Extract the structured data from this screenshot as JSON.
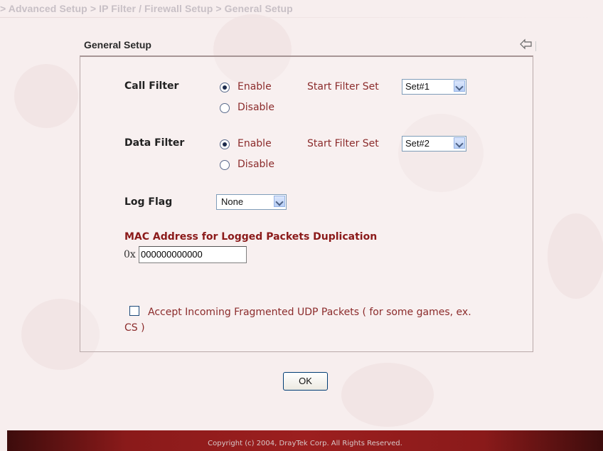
{
  "breadcrumb": "> Advanced Setup > IP Filter / Firewall Setup > General Setup",
  "section_title": "General Setup",
  "icons": {
    "back": "back-arrow-icon"
  },
  "call_filter": {
    "label": "Call Filter",
    "enable_label": "Enable",
    "disable_label": "Disable",
    "selected": "Enable",
    "start_set_label": "Start Filter Set",
    "start_set_value": "Set#1"
  },
  "data_filter": {
    "label": "Data Filter",
    "enable_label": "Enable",
    "disable_label": "Disable",
    "selected": "Enable",
    "start_set_label": "Start Filter Set",
    "start_set_value": "Set#2"
  },
  "log_flag": {
    "label": "Log Flag",
    "value": "None"
  },
  "mac": {
    "title": "MAC Address for Logged Packets Duplication",
    "prefix": "0x",
    "value": "000000000000"
  },
  "udp": {
    "label": "Accept Incoming Fragmented UDP Packets ( for some games, ex. CS )",
    "checked": false
  },
  "ok_label": "OK",
  "footer": "Copyright (c) 2004, DrayTek Corp. All Rights Reserved.",
  "colors": {
    "accent_red": "#8b2b2b",
    "footer_bg": "#8a1a1a",
    "background": "#f7eeee"
  }
}
